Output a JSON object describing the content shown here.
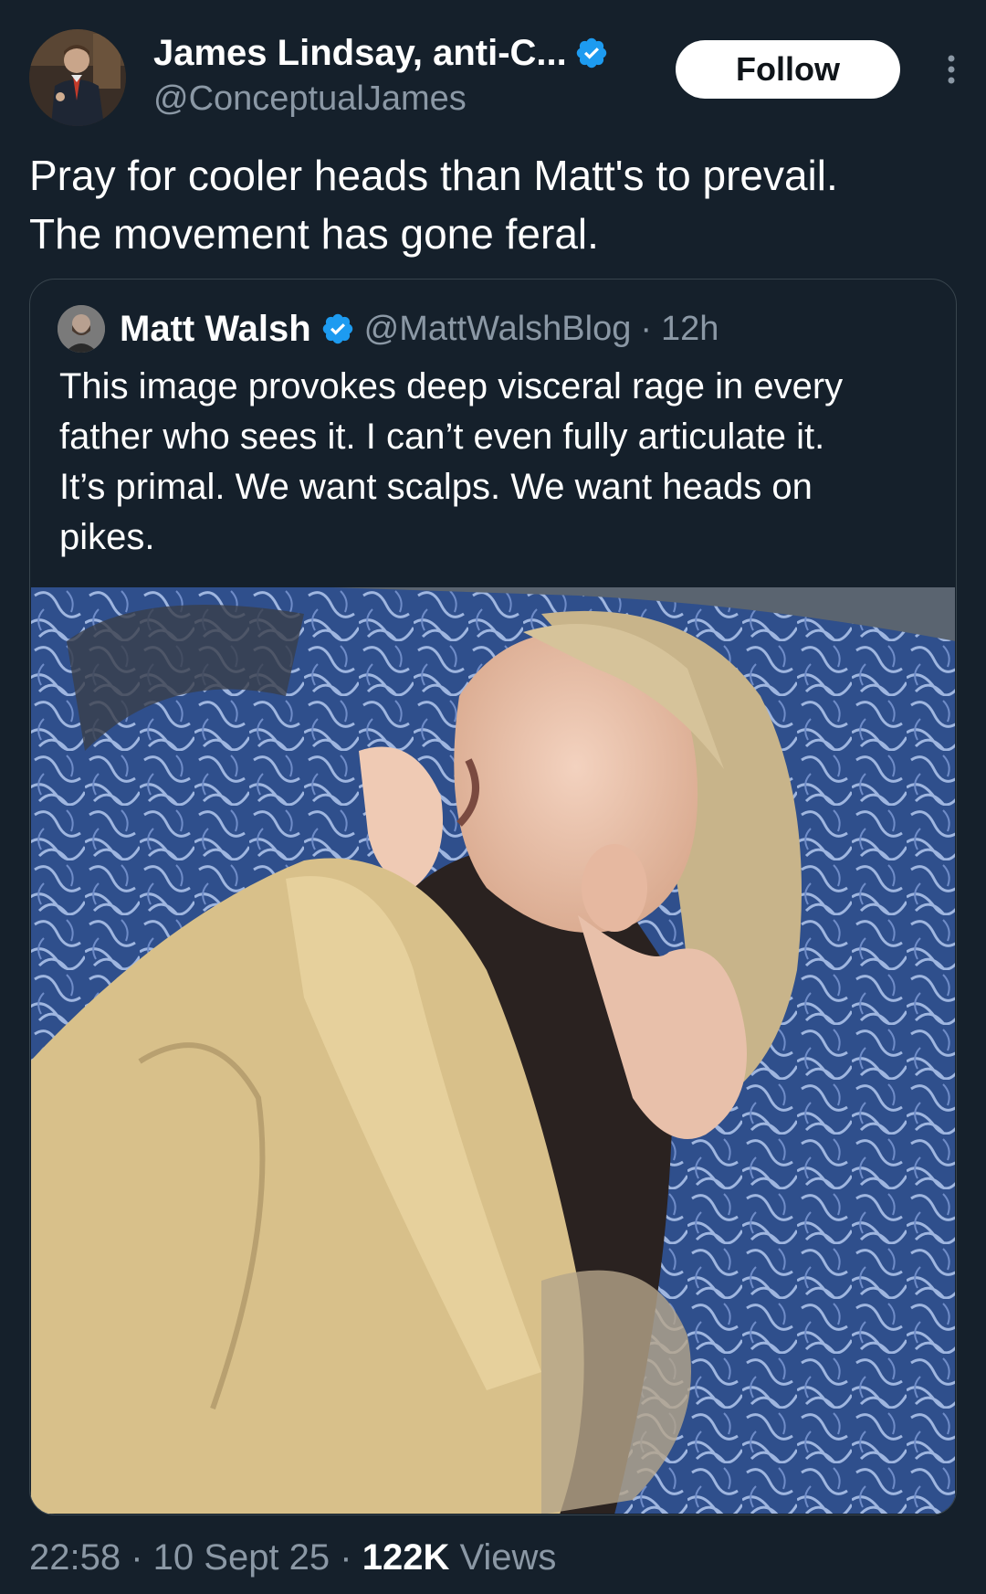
{
  "author": {
    "name": "James Lindsay, anti-C...",
    "handle": "@ConceptualJames",
    "verified": true
  },
  "actions": {
    "follow_label": "Follow",
    "more_icon": "more-vertical-icon"
  },
  "tweet": {
    "line1": "Pray for cooler heads than Matt's to prevail.",
    "line2": "The movement has gone feral."
  },
  "quote": {
    "name": "Matt Walsh",
    "handle": "@MattWalshBlog",
    "dot": "·",
    "time": "12h",
    "line1": "This image provokes deep visceral rage in every",
    "line2": "father who sees it. I can’t even fully articulate it.",
    "line3": "It’s primal. We want scalps. We want heads on",
    "line4": "pikes."
  },
  "meta": {
    "time": "22:58",
    "sep1": " · ",
    "date": "10 Sept 25",
    "sep2": " · ",
    "views_count": "122K",
    "views_label": " Views"
  },
  "colors": {
    "background": "#15202b",
    "secondary_text": "#8b98a5",
    "verified_blue": "#1d9bf0",
    "border": "#38444d"
  }
}
